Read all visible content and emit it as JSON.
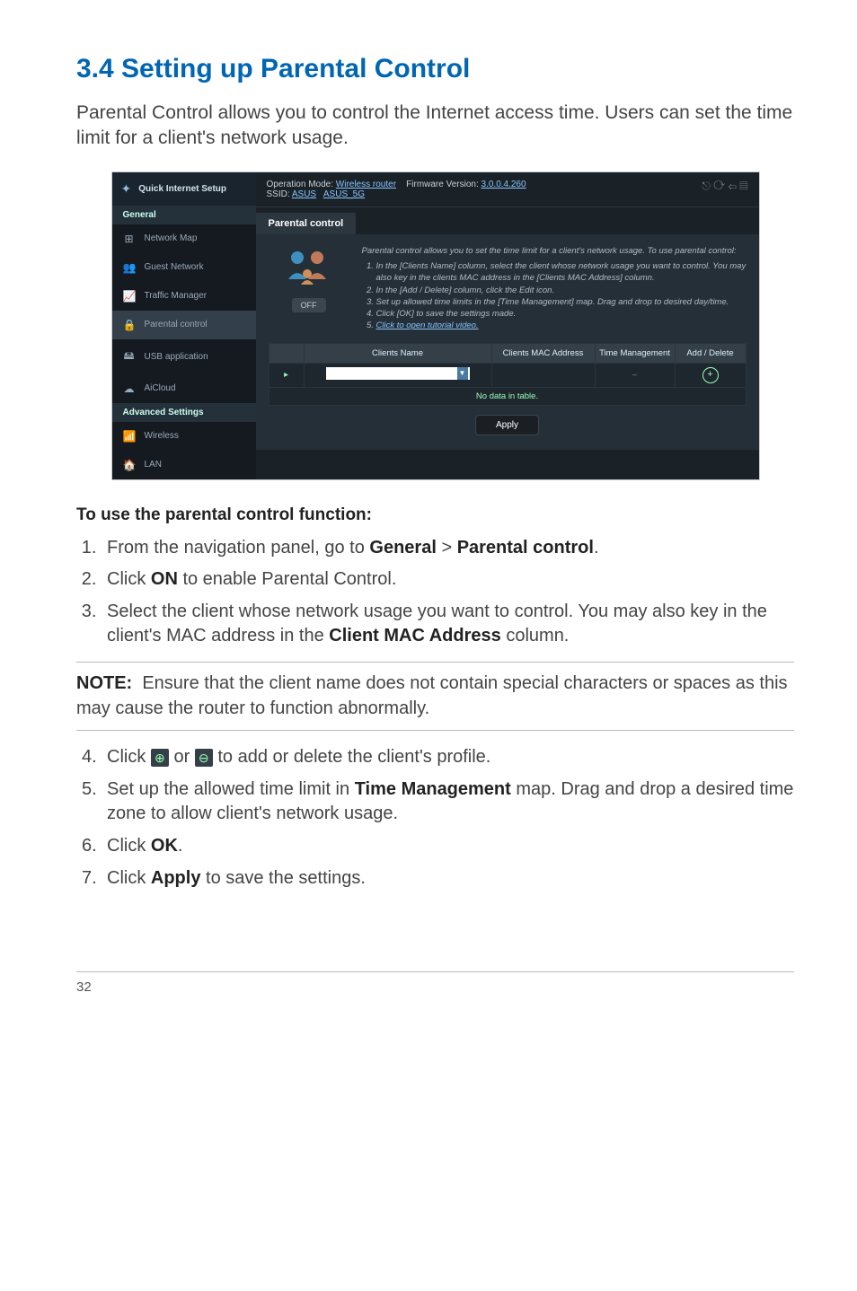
{
  "heading": "3.4   Setting up Parental Control",
  "intro": "Parental Control allows you to control the Internet access time. Users can set the time limit for a client's network usage.",
  "screenshot": {
    "qis": "Quick Internet Setup",
    "general_label": "General",
    "nav": [
      {
        "icon": "⊞",
        "label": "Network Map",
        "name": "nav-network-map"
      },
      {
        "icon": "👥",
        "label": "Guest Network",
        "name": "nav-guest-network"
      },
      {
        "icon": "📈",
        "label": "Traffic Manager",
        "name": "nav-traffic-manager"
      },
      {
        "icon": "🔒",
        "label": "Parental control",
        "name": "nav-parental-control",
        "active": true
      },
      {
        "icon": "🖴",
        "label": "USB application",
        "name": "nav-usb-application"
      },
      {
        "icon": "☁",
        "label": "AiCloud",
        "name": "nav-aicloud"
      }
    ],
    "adv_label": "Advanced Settings",
    "adv": [
      {
        "icon": "📶",
        "label": "Wireless",
        "name": "nav-wireless"
      },
      {
        "icon": "🏠",
        "label": "LAN",
        "name": "nav-lan"
      }
    ],
    "top_mode_label": "Operation Mode:",
    "top_mode": "Wireless router",
    "top_fw_label": "Firmware Version:",
    "top_fw": "3.0.0.4.260",
    "top_ssid_label": "SSID:",
    "top_ssid1": "ASUS",
    "top_ssid2": "ASUS_5G",
    "tab": "Parental control",
    "toggle": "OFF",
    "inst_lead": "Parental control allows you to set the time limit for a client's network usage. To use parental control:",
    "inst": [
      "In the [Clients Name] column, select the client whose network usage you want to control. You may also key in the clients MAC address in the [Clients MAC Address] column.",
      "In the [Add / Delete] column, click the Edit icon.",
      "Set up allowed time limits in the [Time Management] map. Drag and drop to desired day/time.",
      "Click [OK] to save the settings made.",
      "Click to open tutorial video."
    ],
    "cols": [
      "",
      "Clients Name",
      "Clients MAC Address",
      "Time Management",
      "Add / Delete"
    ],
    "nodata": "No data in table.",
    "apply": "Apply"
  },
  "subhead": "To use the parental control function:",
  "steps1": [
    {
      "pre": "From the navigation panel, go to ",
      "b1": "General",
      "mid": " > ",
      "b2": "Parental control",
      "post": "."
    },
    {
      "pre": "Click ",
      "b1": "ON",
      "post": " to enable Parental Control."
    },
    {
      "pre": "Select the client whose network usage you want to control. You may also key in the client's MAC address in the ",
      "b1": "Client MAC Address",
      "post": " column."
    }
  ],
  "note_label": "NOTE:",
  "note_text": "Ensure that the client name does not contain special characters or spaces as this may cause the router to function abnormally.",
  "steps2": [
    {
      "n": "4.",
      "pre": "Click ",
      "icon1": "⊕",
      "mid": " or ",
      "icon2": "⊖",
      "post": " to add or delete the client's profile."
    },
    {
      "n": "5.",
      "pre": "Set up the allowed time limit in ",
      "b1": "Time Management",
      "post": " map. Drag and drop a desired time zone to allow client's network usage."
    },
    {
      "n": "6.",
      "pre": "Click ",
      "b1": "OK",
      "post": "."
    },
    {
      "n": "7.",
      "pre": "Click ",
      "b1": "Apply",
      "post": " to save the settings."
    }
  ],
  "page_num": "32"
}
